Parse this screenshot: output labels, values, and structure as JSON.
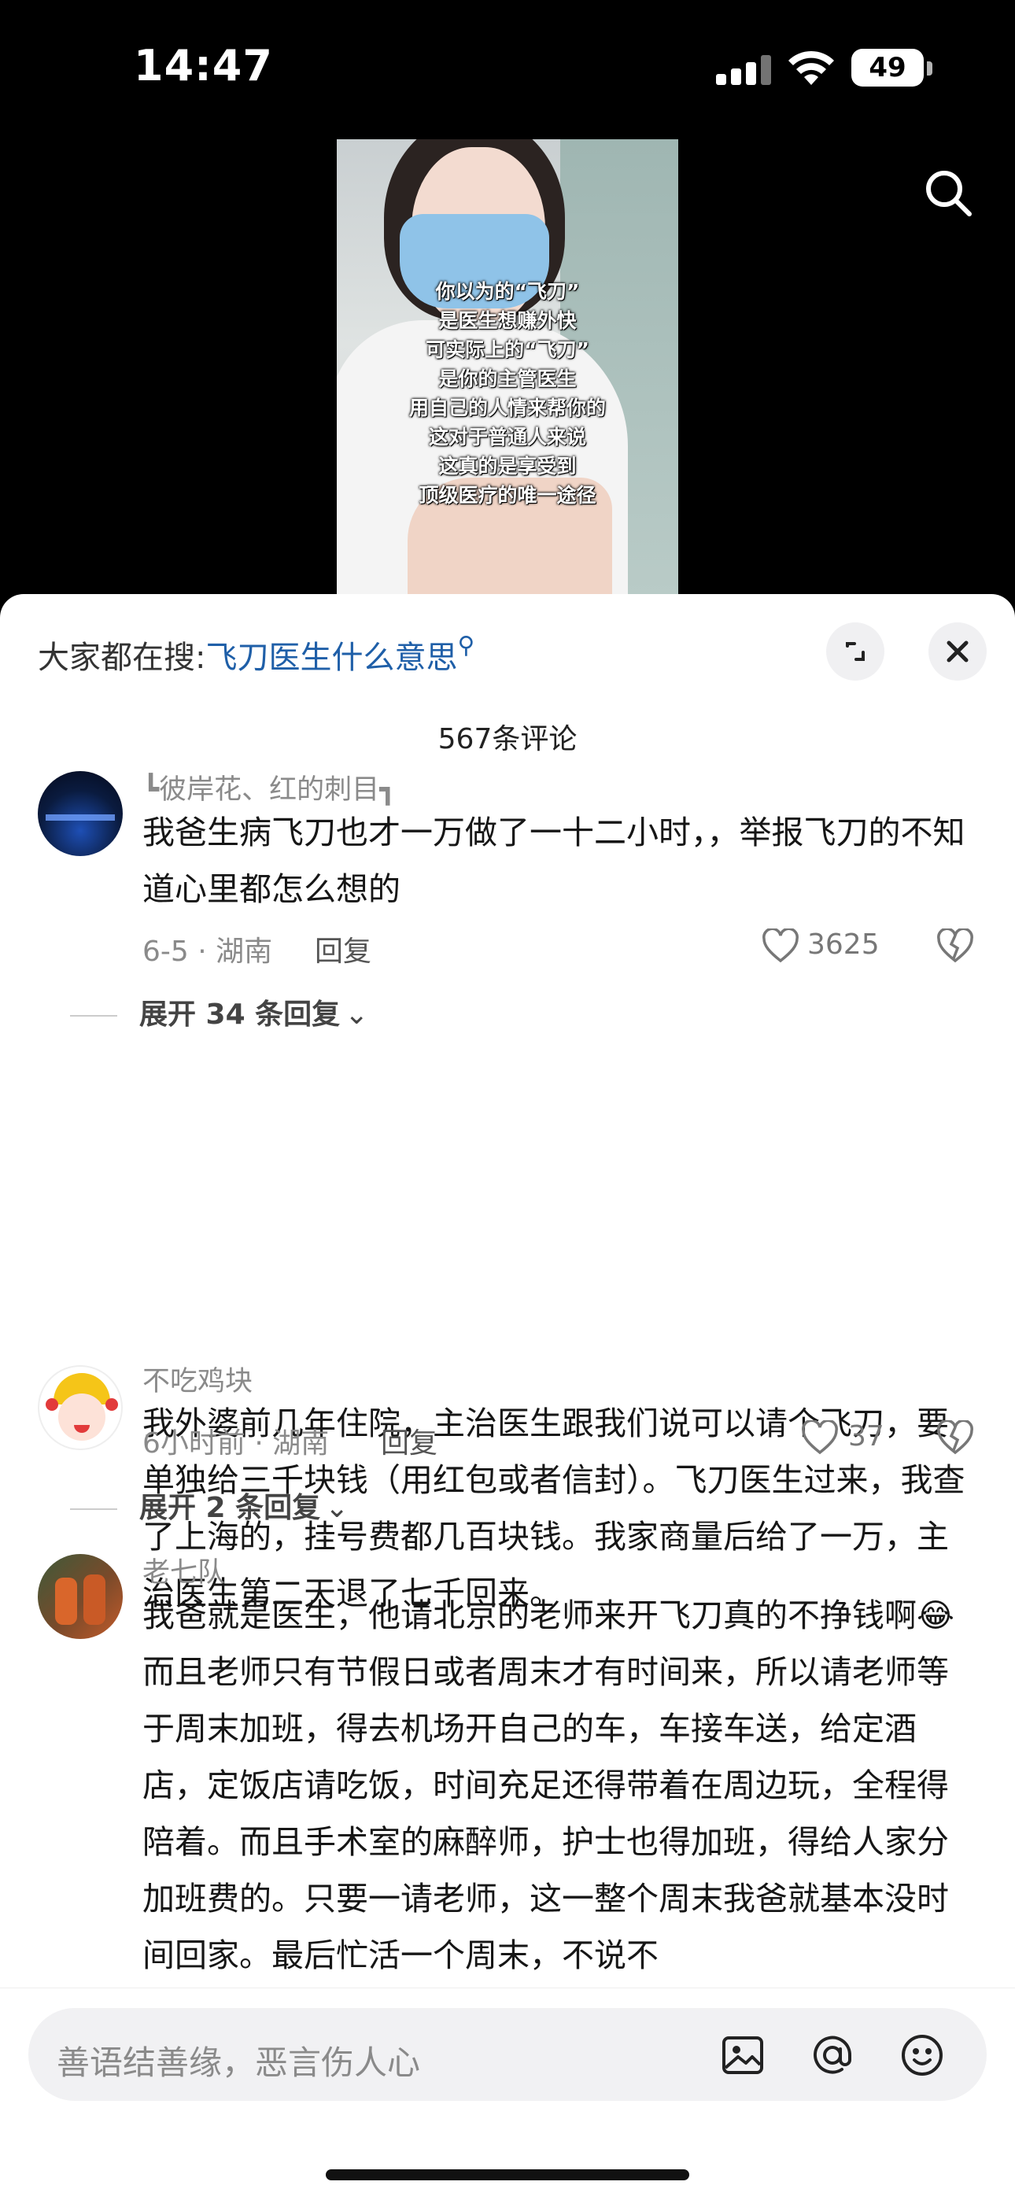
{
  "status_bar": {
    "time": "14:47",
    "battery": "49"
  },
  "video": {
    "overlay_lines": [
      "你以为的“飞刀”",
      "是医生想赚外快",
      "可实际上的“飞刀”",
      "是你的主管医生",
      "用自己的人情来帮你的",
      "这对于普通人来说",
      "这真的是享受到",
      "顶级医疗的唯一途径"
    ]
  },
  "sheet": {
    "hot_search_prefix": "大家都在搜:",
    "hot_search_keyword": "飞刀医生什么意思",
    "comment_count": "567条评论"
  },
  "comments": [
    {
      "username": "┗彼岸花、红的刺目┓",
      "text": "我爸生病飞刀也才一万做了一十二小时，，举报飞刀的不知道心里都怎么想的",
      "meta": "6-5 · 湖南",
      "reply": "回复",
      "likes": "3625",
      "expand": "展开 34 条回复"
    },
    {
      "username": "不吃鸡块",
      "text": "我外婆前几年住院，主治医生跟我们说可以请个飞刀，要单独给三千块钱（用红包或者信封）。飞刀医生过来，我查了上海的，挂号费都几百块钱。我家商量后给了一万，主治医生第二天退了七千回来。",
      "meta": "6小时前 · 湖南",
      "reply": "回复",
      "likes": "37",
      "expand": "展开 2 条回复"
    },
    {
      "username": "老七队",
      "text": "我爸就是医生，他请北京的老师来开飞刀真的不挣钱啊😂而且老师只有节假日或者周末才有时间来，所以请老师等于周末加班，得去机场开自己的车，车接车送，给定酒店，定饭店请吃饭，时间充足还得带着在周边玩，全程得陪着。而且手术室的麻醉师，护士也得加班，得给人家分加班费的。只要一请老师，这一整个周末我爸就基本没时间回家。最后忙活一个周末，不说不"
    }
  ],
  "input": {
    "placeholder": "善语结善缘，恶言伤人心"
  }
}
